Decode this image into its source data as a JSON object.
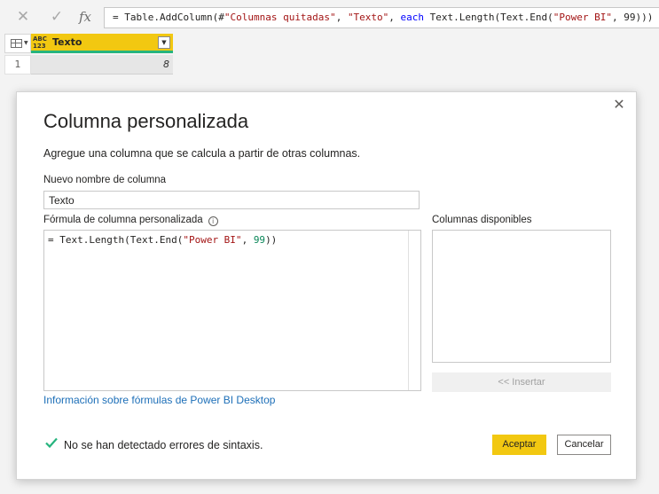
{
  "formula_bar": {
    "cancel_icon": "x-icon",
    "commit_icon": "checkmark-icon",
    "fx_label": "fx",
    "formula_parts": {
      "p1": "= Table.AddColumn(#",
      "p2": "\"Columnas quitadas\"",
      "p3": ", ",
      "p4": "\"Texto\"",
      "p5": ", ",
      "p6": "each",
      "p7": " Text.Length(Text.End(",
      "p8": "\"Power BI\"",
      "p9": ", 99)))"
    }
  },
  "grid": {
    "column": {
      "name": "Texto",
      "type_label_top": "ABC",
      "type_label_bottom": "123",
      "dropdown_icon": "caret-down-icon"
    },
    "rows": [
      {
        "row_number": "1",
        "value": "8"
      }
    ],
    "header_accent": "#f2c811",
    "quality_bar_color": "#26b47e"
  },
  "dialog": {
    "title": "Columna personalizada",
    "description": "Agregue una columna que se calcula a partir de otras columnas.",
    "name_label": "Nuevo nombre de columna",
    "name_value": "Texto",
    "formula_label": "Fórmula de columna personalizada",
    "formula_info_icon": "i",
    "formula_prefix": "= Text.Length(Text.End(",
    "formula_string": "\"Power BI\"",
    "formula_comma": ", ",
    "formula_number": "99",
    "formula_suffix": "))",
    "available_label": "Columnas disponibles",
    "insert_label": "<< Insertar",
    "help_link": "Información sobre fórmulas de Power BI Desktop",
    "status_text": "No se han detectado errores de sintaxis.",
    "ok_label": "Aceptar",
    "cancel_label": "Cancelar",
    "close_icon": "×"
  },
  "colors": {
    "accent": "#f2c811",
    "link": "#1d6fb8",
    "success": "#26b47e",
    "string": "#a31515",
    "keyword": "#0000ff"
  }
}
